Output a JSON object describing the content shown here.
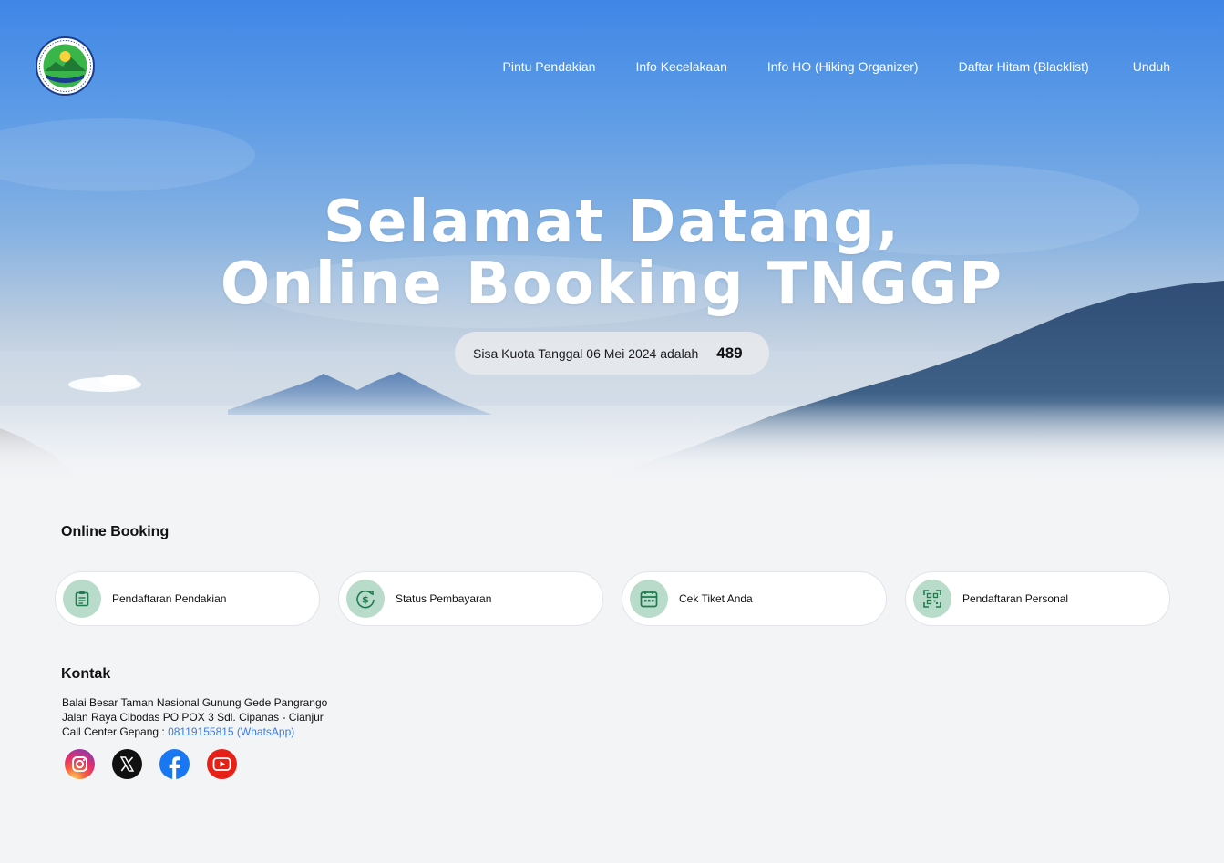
{
  "logo": {
    "text": "TAMAN NASIONAL GUNUNG GEDE PANGRANGO"
  },
  "nav": {
    "items": [
      {
        "label": "Pintu Pendakian"
      },
      {
        "label": "Info Kecelakaan"
      },
      {
        "label": "Info HO (Hiking Organizer)"
      },
      {
        "label": "Daftar Hitam (Blacklist)"
      },
      {
        "label": "Unduh"
      }
    ]
  },
  "hero": {
    "title_line1": "Selamat Datang,",
    "title_line2": "Online Booking TNGGP",
    "quota_text": "Sisa Kuota Tanggal 06 Mei 2024 adalah",
    "quota_value": "489"
  },
  "booking": {
    "title": "Online Booking",
    "cards": [
      {
        "label": "Pendaftaran Pendakian",
        "icon": "clipboard-icon"
      },
      {
        "label": "Status Pembayaran",
        "icon": "dollar-cycle-icon"
      },
      {
        "label": "Cek Tiket Anda",
        "icon": "calendar-icon"
      },
      {
        "label": "Pendaftaran Personal",
        "icon": "qr-scan-icon"
      }
    ]
  },
  "contact": {
    "title": "Kontak",
    "line1": "Balai Besar Taman Nasional Gunung Gede Pangrango",
    "line2": "Jalan Raya Cibodas PO POX 3 Sdl. Cipanas - Cianjur",
    "line3_prefix": "Call Center Gepang : ",
    "phone": "08119155815 (WhatsApp)"
  },
  "socials": [
    "instagram-icon",
    "x-twitter-icon",
    "facebook-icon",
    "youtube-icon"
  ],
  "colors": {
    "accent_green": "#1f7a4d",
    "icon_bg": "#b8dcc9",
    "link_blue": "#3b7be0",
    "page_bg": "#f3f4f6"
  }
}
